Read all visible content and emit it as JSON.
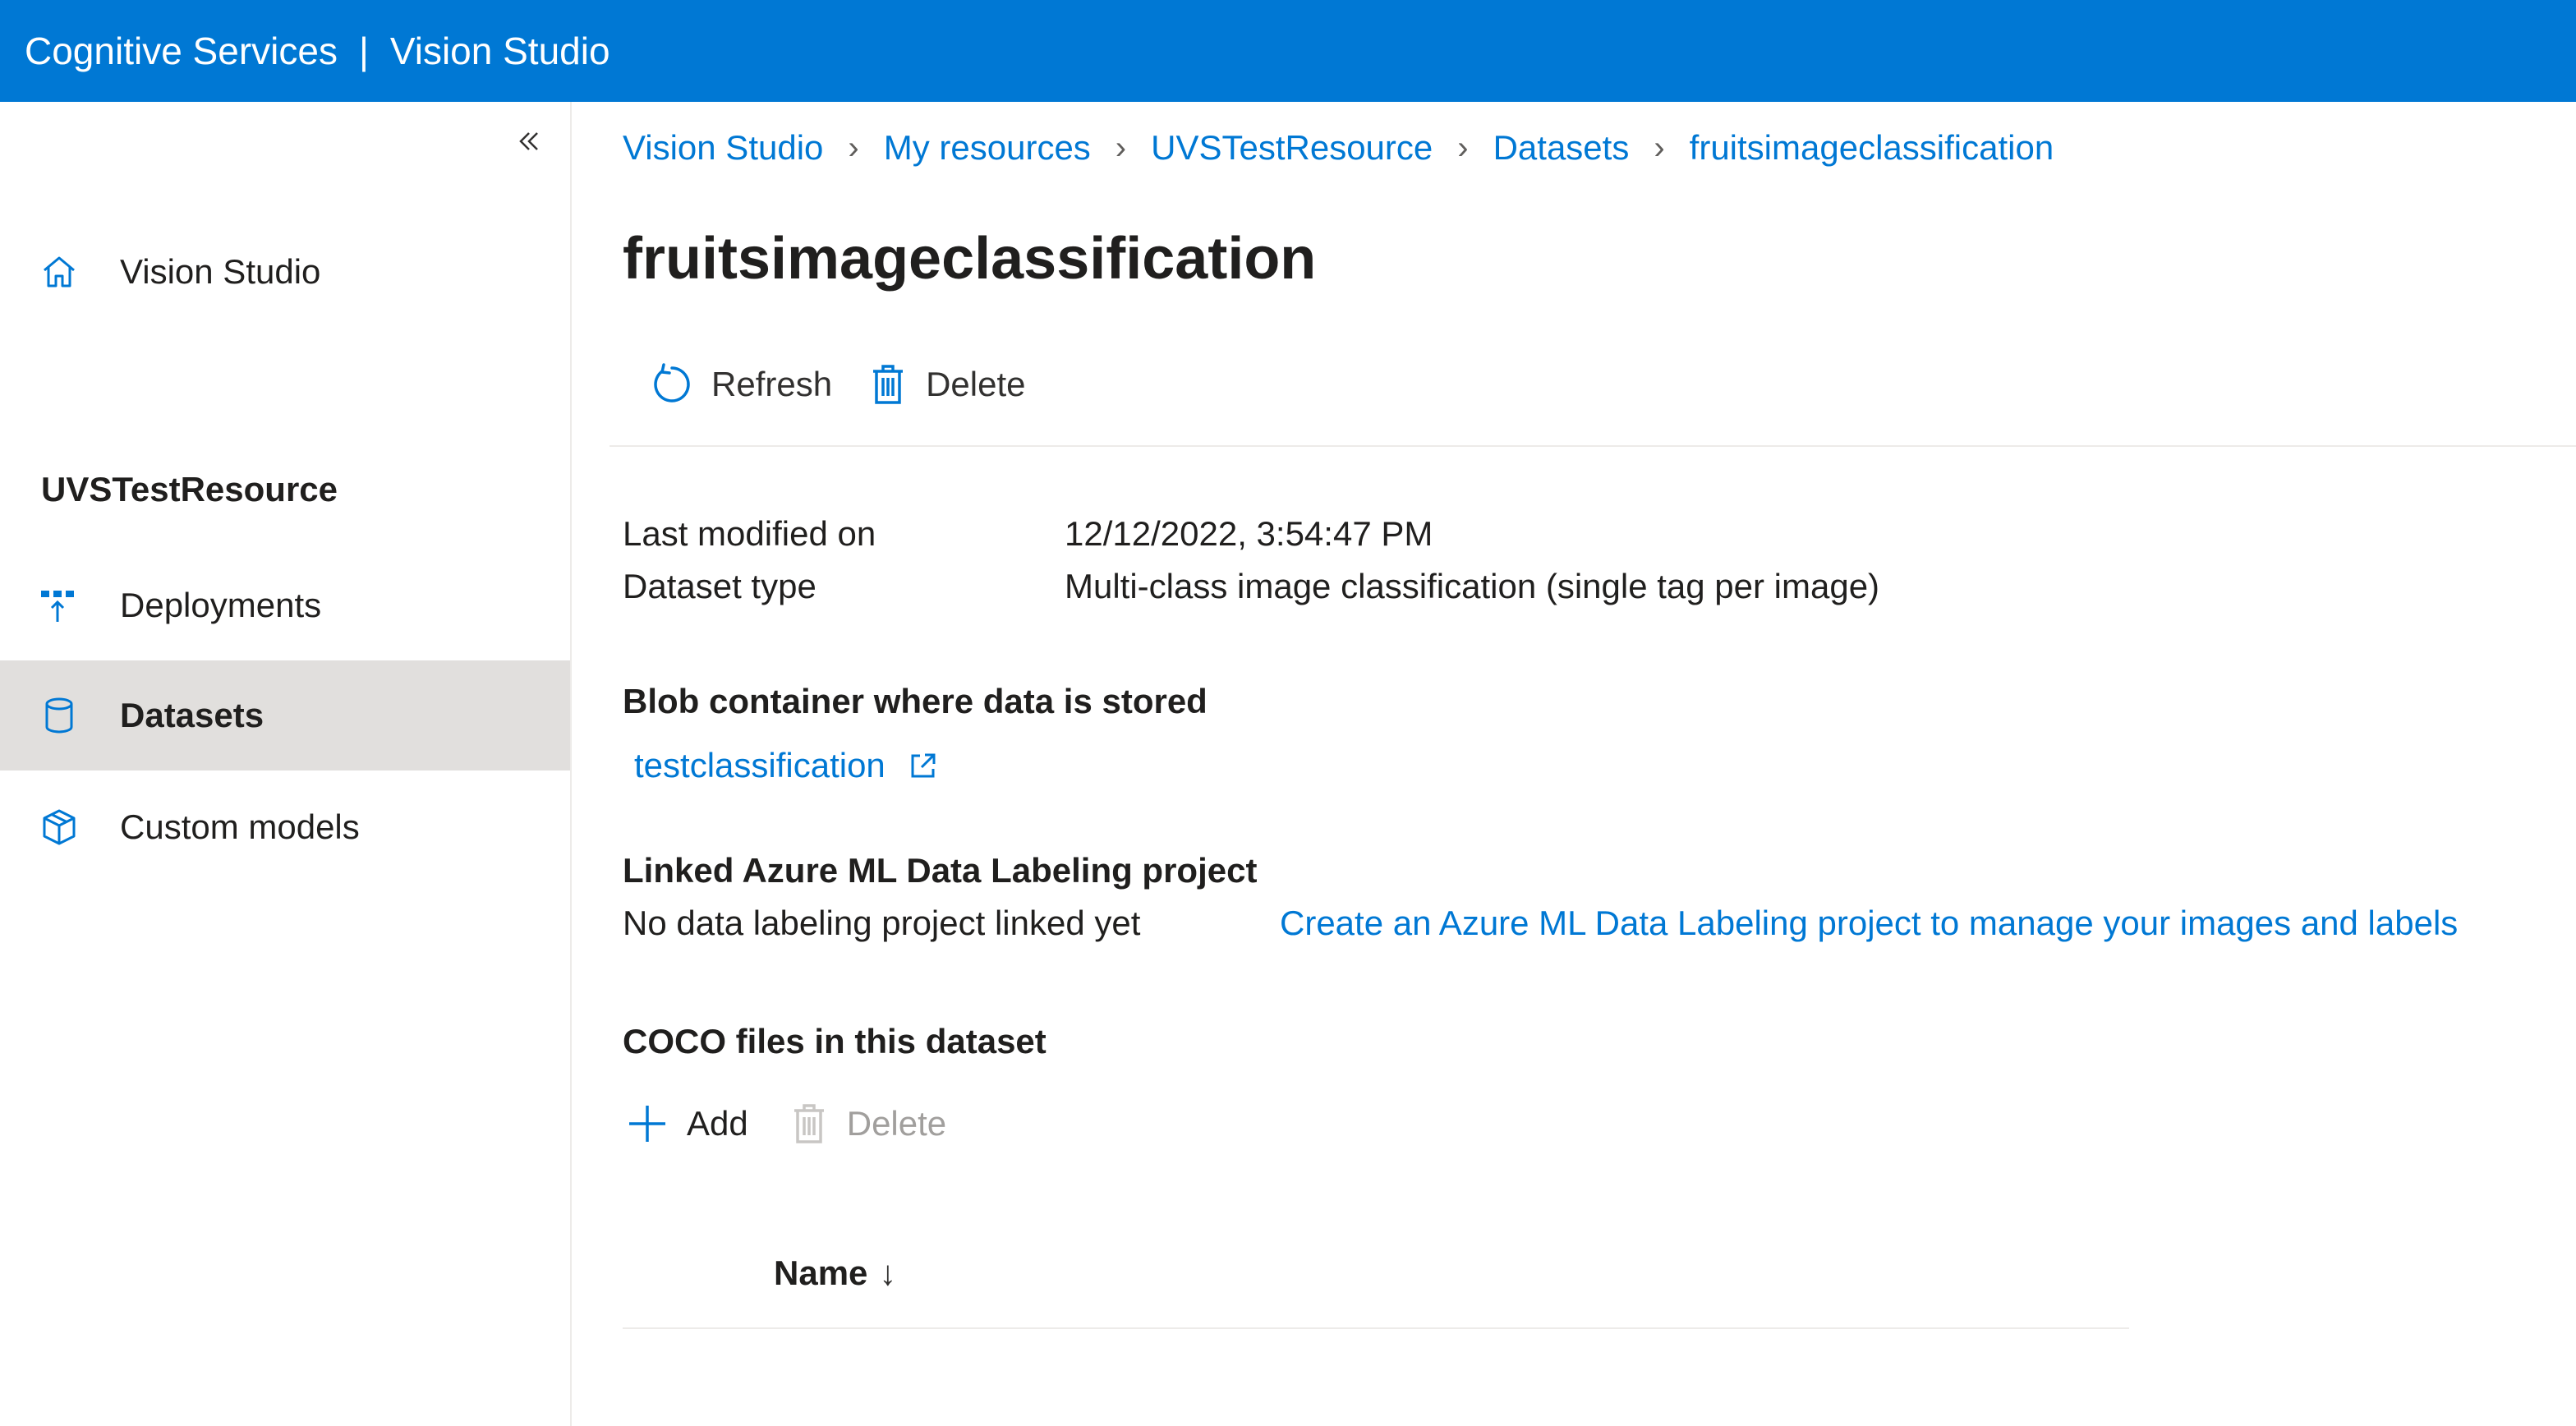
{
  "header": {
    "brand": "Cognitive Services",
    "separator": "|",
    "app": "Vision Studio"
  },
  "sidebar": {
    "collapse_icon": "double-chevron-left-icon",
    "home": {
      "label": "Vision Studio",
      "icon": "home-icon"
    },
    "resource_name": "UVSTestResource",
    "items": [
      {
        "label": "Deployments",
        "icon": "deployments-icon"
      },
      {
        "label": "Datasets",
        "icon": "database-icon",
        "active": true
      },
      {
        "label": "Custom models",
        "icon": "cube-icon"
      }
    ]
  },
  "breadcrumb": [
    "Vision Studio",
    "My resources",
    "UVSTestResource",
    "Datasets",
    "fruitsimageclassification"
  ],
  "page": {
    "title": "fruitsimageclassification",
    "toolbar": {
      "refresh_label": "Refresh",
      "delete_label": "Delete"
    },
    "details": [
      {
        "label": "Last modified on",
        "value": "12/12/2022, 3:54:47 PM"
      },
      {
        "label": "Dataset type",
        "value": "Multi-class image classification (single tag per image)"
      }
    ],
    "blob": {
      "heading": "Blob container where data is stored",
      "link": "testclassification"
    },
    "labeling": {
      "heading": "Linked Azure ML Data Labeling project",
      "status": "No data labeling project linked yet",
      "create_link": "Create an Azure ML Data Labeling project to manage your images and labels"
    },
    "coco": {
      "heading": "COCO files in this dataset",
      "add_label": "Add",
      "delete_label": "Delete",
      "column_name": "Name",
      "sort_indicator": "↓"
    }
  },
  "colors": {
    "accent": "#0078d4",
    "active_nav": "#e1dfdd",
    "text": "#201f1e",
    "disabled": "#a19f9d"
  }
}
